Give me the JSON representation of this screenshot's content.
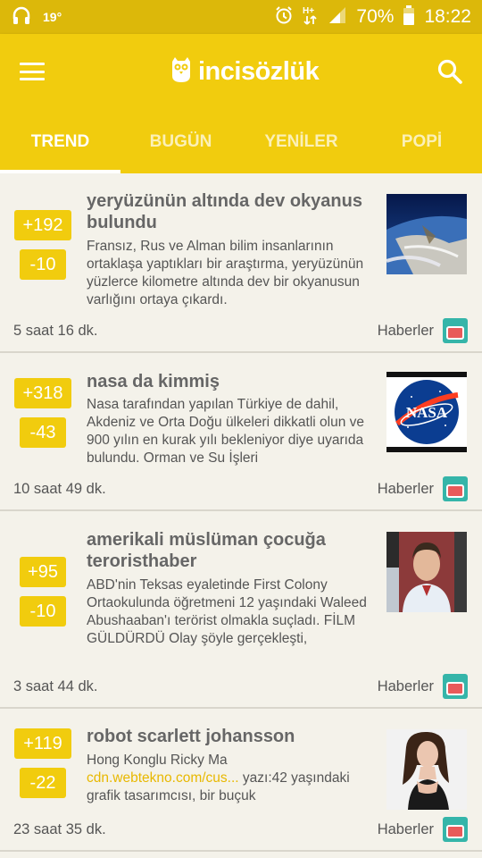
{
  "status_bar": {
    "temperature": "19°",
    "battery": "70%",
    "time": "18:22"
  },
  "app": {
    "logo_text": "incisözlük"
  },
  "tabs": [
    {
      "label": "TREND",
      "active": true
    },
    {
      "label": "BUGÜN",
      "active": false
    },
    {
      "label": "YENİLER",
      "active": false
    },
    {
      "label": "POPİ",
      "active": false
    }
  ],
  "colors": {
    "brand": "#f1cc0e",
    "status_bar": "#dcb80a",
    "background": "#f4f2ea",
    "link": "#e8b800"
  },
  "entries": [
    {
      "upvotes": "+192",
      "downvotes": "-10",
      "title": "yeryüzünün altında dev okyanus bulundu",
      "summary": "Fransız, Rus ve Alman bilim insanlarının ortaklaşa yaptıkları bir araştırma, yeryüzünün yüzlerce kilometre altında dev bir okyanusun varlığını ortaya çıkardı.",
      "link_text": "",
      "summary_rest": "",
      "time": "5 saat 16 dk.",
      "category": "Haberler",
      "thumbnail": "earth-from-space-image"
    },
    {
      "upvotes": "+318",
      "downvotes": "-43",
      "title": "nasa da kimmiş",
      "summary": "Nasa tarafından yapılan Türkiye de dahil, Akdeniz ve Orta Doğu ülkeleri dikkatli olun ve 900 yılın en kurak yılı bekleniyor diye uyarıda bulundu. Orman ve Su İşleri",
      "link_text": "",
      "summary_rest": "",
      "time": "10 saat 49 dk.",
      "category": "Haberler",
      "thumbnail": "nasa-logo-image",
      "thumbnail_text": "NASA"
    },
    {
      "upvotes": "+95",
      "downvotes": "-10",
      "title": "amerikali müslüman çocuğa teroristhaber",
      "summary": "ABD'nin Teksas eyaletinde First Colony Ortaokulunda öğretmeni 12 yaşındaki Waleed Abushaaban'ı terörist olmakla suçladı. FİLM GÜLDÜRDÜ Olay şöyle gerçekleşti,",
      "link_text": "",
      "summary_rest": "",
      "time": "3 saat 44 dk.",
      "category": "Haberler",
      "thumbnail": "boy-portrait-image"
    },
    {
      "upvotes": "+119",
      "downvotes": "-22",
      "title": "robot scarlett johansson",
      "summary": "Hong Konglu Ricky Ma ",
      "link_text": "cdn.webtekno.com/cus...",
      "summary_rest": " yazı:42 yaşındaki grafik tasarımcısı, bir buçuk",
      "time": "23 saat 35 dk.",
      "category": "Haberler",
      "thumbnail": "woman-portrait-image"
    }
  ]
}
